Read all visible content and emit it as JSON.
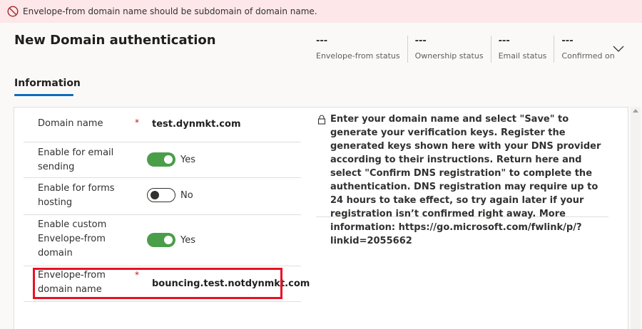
{
  "banner": {
    "message": "Envelope-from domain name should be subdomain of domain name."
  },
  "header": {
    "title": "New Domain authentication",
    "stats": [
      {
        "value": "---",
        "label": "Envelope-from status"
      },
      {
        "value": "---",
        "label": "Ownership status"
      },
      {
        "value": "---",
        "label": "Email status"
      },
      {
        "value": "---",
        "label": "Confirmed on"
      }
    ]
  },
  "tabs": [
    {
      "label": "Information",
      "selected": true
    }
  ],
  "form": {
    "domain_name": {
      "label": "Domain name",
      "required": "*",
      "value": "test.dynmkt.com"
    },
    "email_sending": {
      "label": "Enable for email sending",
      "state": "Yes"
    },
    "forms_hosting": {
      "label": "Enable for forms hosting",
      "state": "No"
    },
    "custom_envelope": {
      "label": "Enable custom Envelope-from domain",
      "state": "Yes"
    },
    "envelope_from": {
      "label": "Envelope-from domain name",
      "required": "*",
      "value": "bouncing.test.notdynmkt.com"
    }
  },
  "info": {
    "text": "Enter your domain name and select \"Save\" to generate your verification keys. Register the generated keys shown here with your DNS provider according to their instructions. Return here and select \"Confirm DNS registration\" to complete the authentication. DNS registration may require up to 24 hours to take effect, so try again later if your registration isn’t confirmed right away. More information: https://go.microsoft.com/fwlink/p/?linkid=2055662"
  },
  "colors": {
    "error_bg": "#fde7e9",
    "error_icon": "#a4262c",
    "toggle_on": "#4a9e4a",
    "tab_accent": "#0f6cbd",
    "highlight": "#e81123"
  }
}
